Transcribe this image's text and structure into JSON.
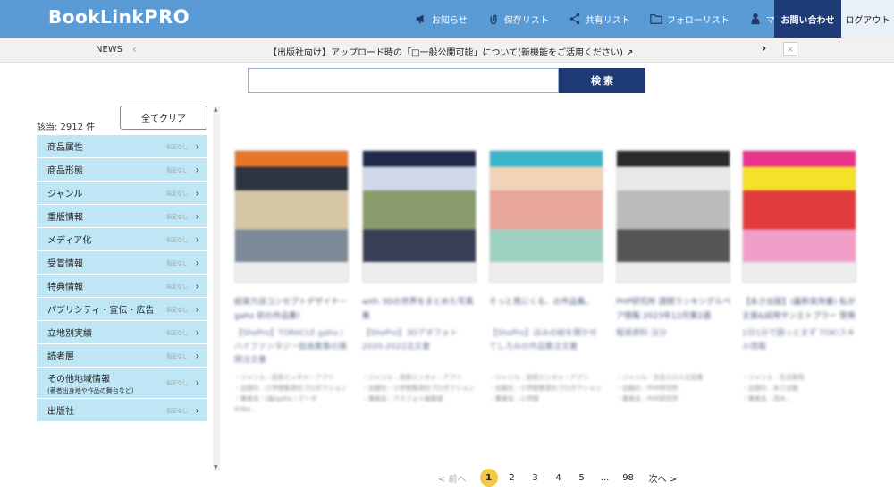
{
  "header": {
    "logo_main": "BookLink",
    "logo_pro": "PRO",
    "nav": [
      {
        "label": "お知らせ",
        "icon": "megaphone-icon"
      },
      {
        "label": "保存リスト",
        "icon": "paperclip-icon"
      },
      {
        "label": "共有リスト",
        "icon": "share-icon"
      },
      {
        "label": "フォローリスト",
        "icon": "folder-icon"
      },
      {
        "label": "マイページ",
        "icon": "person-icon"
      }
    ],
    "contact": "お問い合わせ",
    "logout": "ログアウト"
  },
  "news": {
    "label": "NEWS",
    "prev": "‹",
    "text": "【出版社向け】アップロード時の「□一般公開可能」について(新機能をご活用ください) ↗",
    "next": "›",
    "close": "×"
  },
  "search": {
    "placeholder": "",
    "button": "検 索"
  },
  "sidebar": {
    "count": "該当: 2912 件",
    "clear": "全てクリア",
    "spec_label": "指定なし",
    "items": [
      {
        "label": "商品属性"
      },
      {
        "label": "商品形態"
      },
      {
        "label": "ジャンル"
      },
      {
        "label": "重版情報"
      },
      {
        "label": "メディア化"
      },
      {
        "label": "受賞情報"
      },
      {
        "label": "特典情報"
      },
      {
        "label": "パブリシティ・宣伝・広告"
      },
      {
        "label": "立地別実績"
      },
      {
        "label": "読者層"
      },
      {
        "label": "その他地域情報",
        "sub": "(著者出身地や作品の舞台など)"
      },
      {
        "label": "出版社"
      }
    ]
  },
  "cards": [
    {
      "title": "総実力派コンセプトデザイナーgaho 初の作品集!",
      "sub": "【ShoPro】TORACLE gaho / ハイファンタジー総画集集の展開注文書",
      "meta": [
        "・ジャンル : 芸術エンタメ・アプリ",
        "・出版社 : 小学館集英社プロダクション",
        "・著者名 : (画)gaho / データ",
        "9784..."
      ],
      "palette": [
        "#e8762a",
        "#2e3440",
        "#d7c6a5",
        "#7c8a99"
      ]
    },
    {
      "title": "with 3Dの世界をまとめた写真集",
      "sub": "【ShoPro】3Dアオフォト 2020-2022注文書",
      "meta": [
        "・ジャンル : 芸術エンタメ・アプリ",
        "・出版社 : 小学館集英社プロダクション",
        "・著者名 : アオフォト編集部"
      ],
      "palette": [
        "#1f2a4a",
        "#cfd8e8",
        "#8a9a6a",
        "#3a3f55"
      ]
    },
    {
      "title": "そっと見にくる、の作品集。",
      "sub": "【ShoPro】ほみの絵を開かせてしろみの作品集注文書",
      "meta": [
        "・ジャンル : 芸術エンタメ・アプリ",
        "・出版社 : 小学館集英社プロダクション",
        "・著者名 : 小学館"
      ],
      "palette": [
        "#3ab5c9",
        "#f2d3b8",
        "#e8a59a",
        "#9fd1c2"
      ]
    },
    {
      "title": "PHP研究所 週間ランキングルペア情報 2023年12月第2週",
      "sub": "報道資料 注分",
      "meta": [
        "・ジャンル : 文芸エロ人文芸書",
        "・出版社 : PHP研究所",
        "・著者名 : PHP研究所"
      ],
      "palette": [
        "#2a2a2a",
        "#e9e9e9",
        "#bbbbbb",
        "#555555"
      ]
    },
    {
      "title": "【あさ出版】(最新実用書) 私が主張&試用サンエトプラー 受発中",
      "sub": "1日1分で困っとまず TOK!スキル情報",
      "meta": [
        "・ジャンル : 生活実用",
        "・出版社 : あさ出版",
        "・著者名 : 茂木..."
      ],
      "palette": [
        "#e8358a",
        "#f5e02a",
        "#e23b3b",
        "#f0a0c8"
      ]
    }
  ],
  "pagination": {
    "prev": "< 前へ",
    "pages": [
      "1",
      "2",
      "3",
      "4",
      "5",
      "...",
      "98"
    ],
    "next": "次へ >"
  }
}
